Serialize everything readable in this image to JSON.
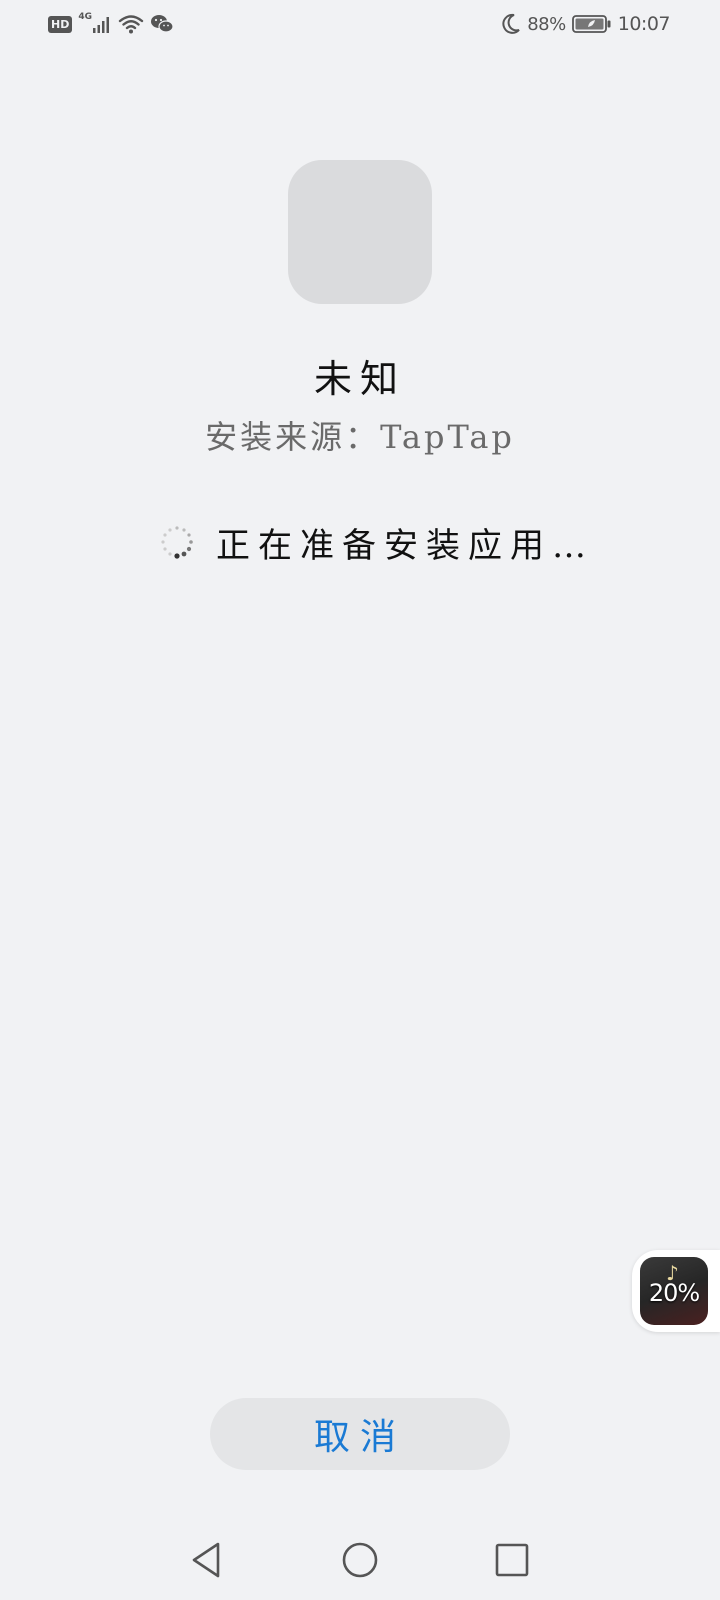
{
  "status_bar": {
    "hd_label": "HD",
    "network_label": "4G",
    "icons": [
      "signal-icon",
      "wifi-icon",
      "wechat-icon",
      "moon-icon",
      "battery-icon"
    ],
    "battery_percent": "88%",
    "time": "10:07"
  },
  "app": {
    "name": "未知",
    "source": "安装来源：TapTap"
  },
  "progress": {
    "text": "正在准备安装应用…"
  },
  "float_widget": {
    "percent": "20%",
    "icon": "music-note-icon"
  },
  "cancel_button": {
    "label": "取消"
  },
  "colors": {
    "background": "#f1f2f4",
    "accent": "#1a7ad4",
    "icon_placeholder": "#dadbdd",
    "button_bg": "#e4e5e7"
  },
  "nav_bar": {
    "icons": [
      "back-icon",
      "home-icon",
      "recent-apps-icon"
    ]
  }
}
